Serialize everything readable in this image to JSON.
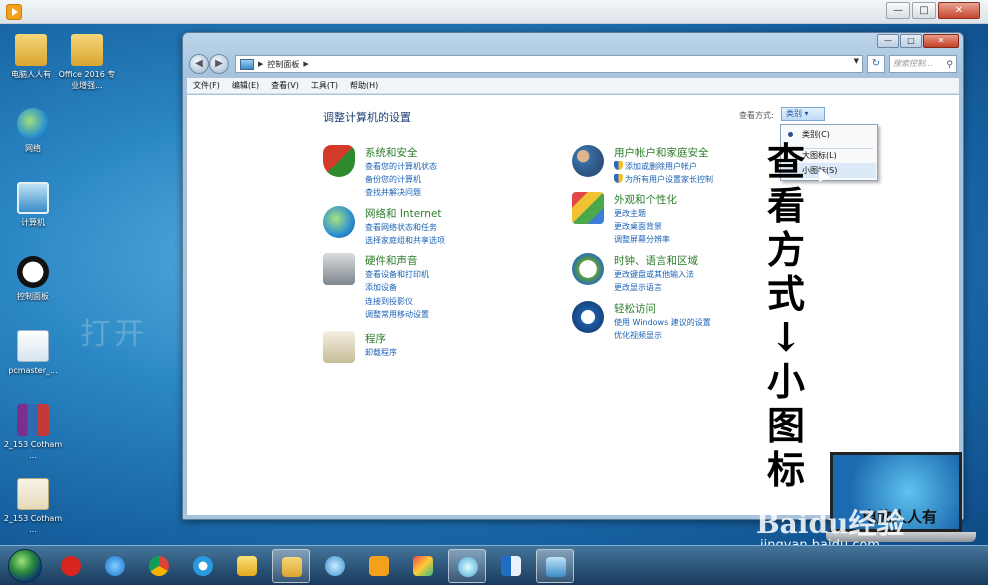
{
  "desktop": {
    "icons": [
      {
        "label": "电脑人人有",
        "icon": "folder-icon"
      },
      {
        "label": "Office 2016 专业增强...",
        "icon": "folder-icon"
      },
      {
        "label": "网络",
        "icon": "network-icon"
      },
      {
        "label": "计算机",
        "icon": "computer-icon"
      },
      {
        "label": "控制面板",
        "icon": "control-panel-icon"
      },
      {
        "label": "pcmaster_...",
        "icon": "file-icon"
      },
      {
        "label": "2_153 Cotham ...",
        "icon": "rar-icon"
      },
      {
        "label": "2_153 Cotham ...",
        "icon": "pdf-icon"
      }
    ],
    "watermark": "打开"
  },
  "window": {
    "address": "控制面板",
    "search_placeholder": "搜索控制...",
    "menu": [
      "文件(F)",
      "编辑(E)",
      "查看(V)",
      "工具(T)",
      "帮助(H)"
    ]
  },
  "control_panel": {
    "title": "调整计算机的设置",
    "view_by_label": "查看方式:",
    "view_by_value": "类别",
    "categories": [
      {
        "title": "系统和安全",
        "links": [
          "查看您的计算机状态",
          "备份您的计算机",
          "查找并解决问题"
        ]
      },
      {
        "title": "网络和 Internet",
        "links": [
          "查看网络状态和任务",
          "选择家庭组和共享选项"
        ]
      },
      {
        "title": "硬件和声音",
        "links": [
          "查看设备和打印机",
          "添加设备",
          "连接到投影仪",
          "调整常用移动设置"
        ]
      },
      {
        "title": "程序",
        "links": [
          "卸载程序"
        ]
      },
      {
        "title": "用户帐户和家庭安全",
        "links": [
          "添加或删除用户帐户",
          "为所有用户设置家长控制"
        ]
      },
      {
        "title": "外观和个性化",
        "links": [
          "更改主题",
          "更改桌面背景",
          "调整屏幕分辨率"
        ]
      },
      {
        "title": "时钟、语言和区域",
        "links": [
          "更改键盘或其他输入法",
          "更改显示语言"
        ]
      },
      {
        "title": "轻松访问",
        "links": [
          "使用 Windows 建议的设置",
          "优化视频显示"
        ]
      }
    ],
    "dropdown": [
      "类别(C)",
      "大图标(L)",
      "小图标(S)"
    ]
  },
  "annotation": {
    "line1": "查",
    "line2": "看",
    "line3": "方",
    "line4": "式",
    "arrow": "↓",
    "line5": "小",
    "line6": "图",
    "line7": "标"
  },
  "overlay": {
    "laptop_text": "电脑人人有",
    "brand": "Baidu经验",
    "url": "jingyan.baidu.com"
  }
}
